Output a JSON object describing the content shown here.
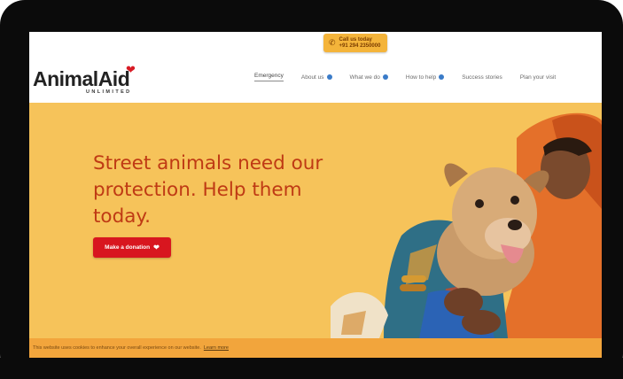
{
  "header": {
    "phone_badge": {
      "icon": "phone-icon",
      "line1": "Call us today",
      "line2": "+91 294 2350000"
    },
    "logo": {
      "word_main": "Animal",
      "word_aid": "Aid",
      "subtitle": "UNLIMITED",
      "heart_color": "#d81b25"
    },
    "nav": [
      {
        "label": "Emergency",
        "active": true,
        "has_dot": false
      },
      {
        "label": "About us",
        "active": false,
        "has_dot": true
      },
      {
        "label": "What we do",
        "active": false,
        "has_dot": true
      },
      {
        "label": "How to help",
        "active": false,
        "has_dot": true
      },
      {
        "label": "Success stories",
        "active": false,
        "has_dot": false
      },
      {
        "label": "Plan your visit",
        "active": false,
        "has_dot": false
      }
    ]
  },
  "hero": {
    "title": "Street animals need our protection. Help them today.",
    "donate_label": "Make a donation",
    "donate_icon": "heart-icon",
    "background_color": "#f6c35a",
    "title_color": "#bf3a14",
    "button_color": "#d8161f"
  },
  "cookie": {
    "text": "This website uses cookies to enhance your overall experience on our website.",
    "link": "Learn more",
    "background_color": "#f2a53c"
  }
}
